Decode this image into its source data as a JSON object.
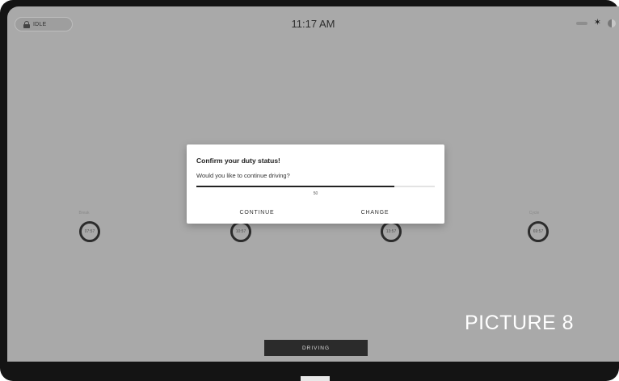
{
  "status_bar": {
    "state_label": "IDLE",
    "time": "11:17 AM",
    "icons": [
      "lock-icon",
      "signal-icon",
      "bluetooth-icon",
      "brightness-icon"
    ]
  },
  "clocks": [
    {
      "label": "Break",
      "value": "07:57"
    },
    {
      "label": "",
      "value": "10:57"
    },
    {
      "label": "",
      "value": "13:57"
    },
    {
      "label": "Cycle",
      "value": "69:57"
    }
  ],
  "dialog": {
    "title": "Confirm your duty status!",
    "message": "Would you like to continue driving?",
    "countdown": {
      "value": "50",
      "progress": 0.83
    },
    "continue_label": "CONTINUE",
    "change_label": "CHANGE"
  },
  "driving_button_label": "DRIVING",
  "overlay_caption": "PICTURE 8",
  "colors": {
    "screen_bg": "#a9a9a9",
    "dialog_bg": "#ffffff",
    "progress": "#222222",
    "device_frame": "#141414"
  }
}
